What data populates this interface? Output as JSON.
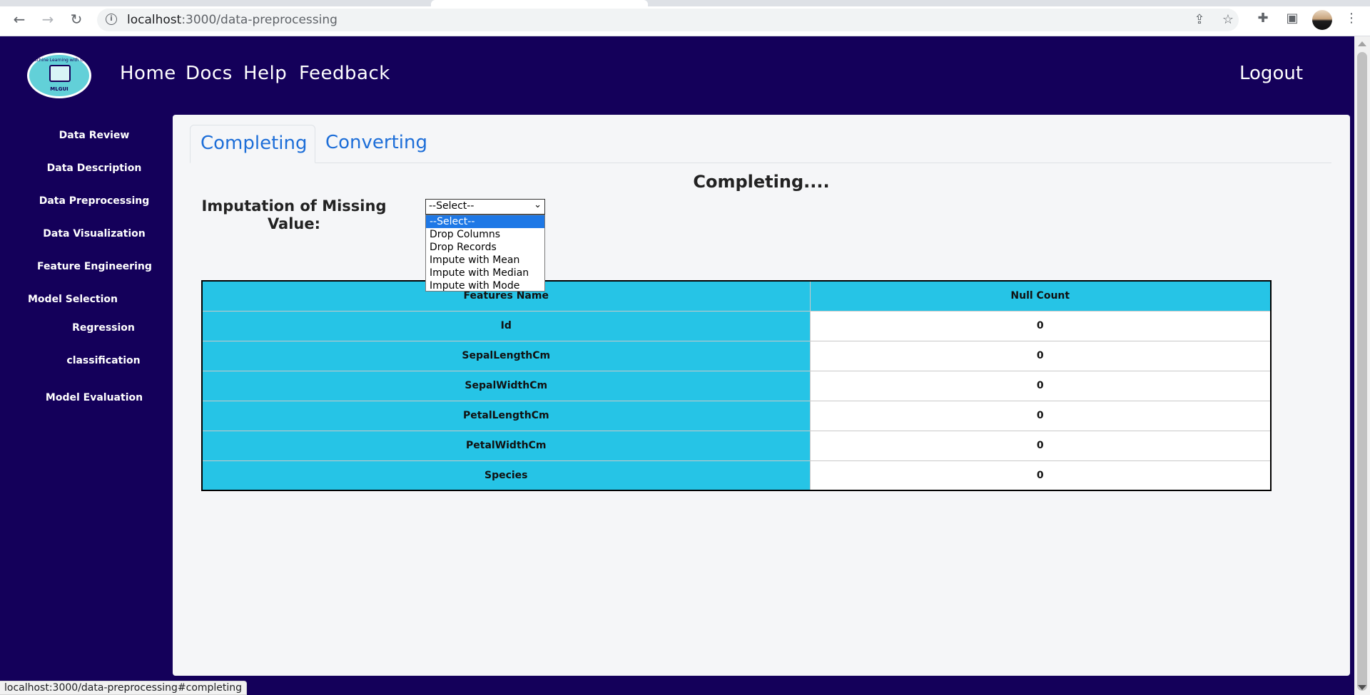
{
  "browser": {
    "url_host": "localhost",
    "url_path": ":3000/data-preprocessing"
  },
  "logo": {
    "ring_text": "Machine Learning with GUI",
    "caption": "MLGUI"
  },
  "nav": {
    "home": "Home",
    "docs": "Docs",
    "help": "Help",
    "feedback": "Feedback",
    "logout": "Logout"
  },
  "sidebar": {
    "items": [
      "Data Review",
      "Data Description",
      "Data Preprocessing",
      "Data Visualization",
      "Feature Engineering",
      "Model Selection",
      "Regression",
      "classification",
      "Model Evaluation"
    ]
  },
  "tabs": {
    "completing": "Completing",
    "converting": "Converting"
  },
  "main": {
    "heading": "Completing....",
    "imputation_label": "Imputation of Missing Value:",
    "select_value": "--Select--",
    "options": [
      "--Select--",
      "Drop Columns",
      "Drop Records",
      "Impute with Mean",
      "Impute with Median",
      "Impute with Mode"
    ]
  },
  "table": {
    "headers": [
      "Features Name",
      "Null Count"
    ],
    "rows": [
      [
        "Id",
        "0"
      ],
      [
        "SepalLengthCm",
        "0"
      ],
      [
        "SepalWidthCm",
        "0"
      ],
      [
        "PetalLengthCm",
        "0"
      ],
      [
        "PetalWidthCm",
        "0"
      ],
      [
        "Species",
        "0"
      ]
    ]
  },
  "status_bar": "localhost:3000/data-preprocessing#completing",
  "colors": {
    "background": "#14005a",
    "table_cyan": "#26c4e6",
    "tab_blue": "#1d6ed8",
    "dropdown_selected": "#1e78e6"
  }
}
